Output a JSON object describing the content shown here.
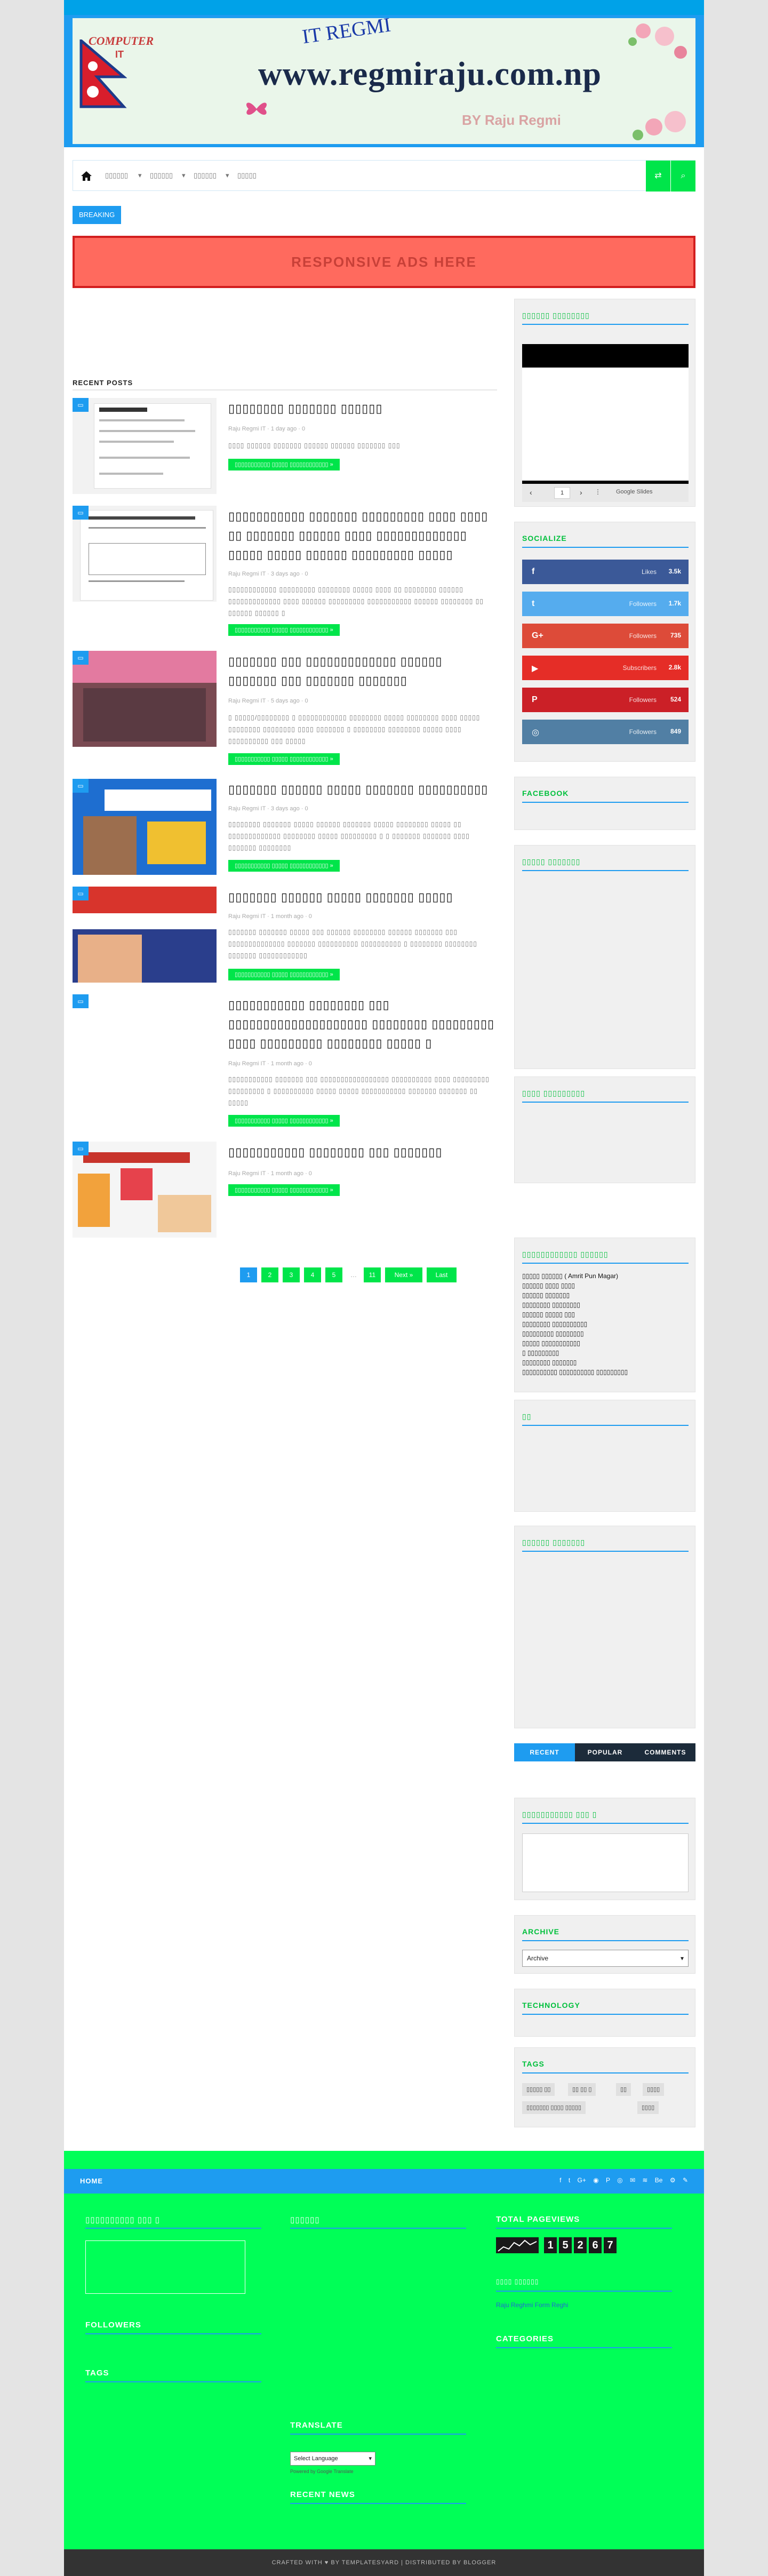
{
  "header": {
    "brand_name": "COMPUTER",
    "brand_suffix": "IT",
    "site_title": "IT REGMI",
    "domain": "www.regmiraju.com.np",
    "byline": "BY Raju Regmi"
  },
  "nav": {
    "items": [
      "▯▯▯▯▯▯",
      "▯▯▯▯▯▯",
      "▯▯▯▯▯▯",
      "▯▯▯▯▯"
    ],
    "shuffle_icon": "shuffle-icon",
    "search_icon": "search-icon"
  },
  "breaking_label": "BREAKING",
  "ads_text": "RESPONSIVE ADS HERE",
  "recent_posts": {
    "title": "RECENT POSTS",
    "read_more": "▯▯▯▯▯▯▯▯▯▯▯ ▯▯▯▯▯ ▯▯▯▯▯▯▯▯▯▯▯▯ »",
    "posts": [
      {
        "title": "▯▯▯▯▯▯▯▯ ▯▯▯▯▯▯▯ ▯▯▯▯▯▯",
        "meta": "Raju Regmi IT  ·  1 day ago  ·  0",
        "excerpt": "▯▯▯▯ ▯▯▯▯▯▯ ▯▯▯▯▯▯▯ ▯▯▯▯▯▯ ▯▯▯▯▯▯ ▯▯▯▯▯▯▯ ▯▯▯"
      },
      {
        "title": "▯▯▯▯▯▯▯▯▯▯▯ ▯▯▯▯▯▯▯ ▯▯▯▯▯▯▯▯▯ ▯▯▯▯ ▯▯▯▯ ▯▯ ▯▯▯▯▯▯▯ ▯▯▯▯▯▯ ▯▯▯▯ ▯▯▯▯▯▯▯▯▯▯▯▯▯ ▯▯▯▯▯ ▯▯▯▯▯ ▯▯▯▯▯▯ ▯▯▯▯▯▯▯▯▯ ▯▯▯▯▯",
        "meta": "Raju Regmi IT  ·  3 days ago  ·  0",
        "excerpt": "▯▯▯▯▯▯▯▯▯▯▯▯ ▯▯▯▯▯▯▯▯▯ ▯▯▯▯▯▯▯▯ ▯▯▯▯▯ ▯▯▯▯ ▯▯ ▯▯▯▯▯▯▯▯ ▯▯▯▯▯▯ ▯▯▯▯▯▯▯▯▯▯▯▯▯ ▯▯▯▯ ▯▯▯▯▯▯ ▯▯▯▯▯▯▯▯▯ ▯▯▯▯▯▯▯▯▯▯▯ ▯▯▯▯▯▯ ▯▯▯▯▯▯▯▯ ▯▯ ▯▯▯▯▯▯ ▯▯▯▯▯▯ ▯"
      },
      {
        "title": "▯▯▯▯▯▯▯ ▯▯▯ ▯▯▯▯▯▯▯▯▯▯▯▯▯ ▯▯▯▯▯▯ ▯▯▯▯▯▯▯ ▯▯▯ ▯▯▯▯▯▯▯ ▯▯▯▯▯▯▯",
        "meta": "Raju Regmi IT  ·  5 days ago  ·  0",
        "excerpt": "▯ ▯▯▯▯▯/▯▯▯▯▯▯▯▯ ▯ ▯▯▯▯▯▯▯▯▯▯▯▯ ▯▯▯▯▯▯▯▯ ▯▯▯▯▯ ▯▯▯▯▯▯▯▯ ▯▯▯▯ ▯▯▯▯▯ ▯▯▯▯▯▯▯▯ ▯▯▯▯▯▯▯▯ ▯▯▯▯ ▯▯▯▯▯▯▯ ▯ ▯▯▯▯▯▯▯▯ ▯▯▯▯▯▯▯▯ ▯▯▯▯▯ ▯▯▯▯ ▯▯▯▯▯▯▯▯▯▯ ▯▯▯ ▯▯▯▯▯"
      },
      {
        "title": "▯▯▯▯▯▯▯ ▯▯▯▯▯▯ ▯▯▯▯▯ ▯▯▯▯▯▯▯ ▯▯▯▯▯▯▯▯▯▯",
        "meta": "Raju Regmi IT  ·  3 days ago  ·  0",
        "excerpt": "▯▯▯▯▯▯▯▯ ▯▯▯▯▯▯▯ ▯▯▯▯▯ ▯▯▯▯▯▯ ▯▯▯▯▯▯▯ ▯▯▯▯▯ ▯▯▯▯▯▯▯▯ ▯▯▯▯▯ ▯▯ ▯▯▯▯▯▯▯▯▯▯▯▯▯ ▯▯▯▯▯▯▯▯ ▯▯▯▯▯ ▯▯▯▯▯▯▯▯▯ ▯ ▯ ▯▯▯▯▯▯▯ ▯▯▯▯▯▯▯ ▯▯▯▯ ▯▯▯▯▯▯▯ ▯▯▯▯▯▯▯▯"
      },
      {
        "title": "▯▯▯▯▯▯▯ ▯▯▯▯▯▯ ▯▯▯▯▯ ▯▯▯▯▯▯▯ ▯▯▯▯▯",
        "meta": "Raju Regmi IT  ·  1 month ago  ·  0",
        "excerpt": "▯▯▯▯▯▯▯ ▯▯▯▯▯▯▯ ▯▯▯▯▯ ▯▯▯ ▯▯▯▯▯▯ ▯▯▯▯▯▯▯▯ ▯▯▯▯▯▯ ▯▯▯▯▯▯▯ ▯▯▯ ▯▯▯▯▯▯▯▯▯▯▯▯▯▯ ▯▯▯▯▯▯▯ ▯▯▯▯▯▯▯▯▯▯ ▯▯▯▯▯▯▯▯▯▯ ▯ ▯▯▯▯▯▯▯▯ ▯▯▯▯▯▯▯▯ ▯▯▯▯▯▯▯ ▯▯▯▯▯▯▯▯▯▯▯▯"
      },
      {
        "title": "▯▯▯▯▯▯▯▯▯▯▯ ▯▯▯▯▯▯▯▯ ▯▯▯ ▯▯▯▯▯▯▯▯▯▯▯▯▯▯▯▯▯▯▯▯ ▯▯▯▯▯▯▯▯ ▯▯▯▯▯▯▯▯▯ ▯▯▯▯ ▯▯▯▯▯▯▯▯▯ ▯▯▯▯▯▯▯▯ ▯▯▯▯▯ ▯",
        "meta": "Raju Regmi IT  ·  1 month ago  ·  0",
        "excerpt": "▯▯▯▯▯▯▯▯▯▯▯ ▯▯▯▯▯▯▯ ▯▯▯ ▯▯▯▯▯▯▯▯▯▯▯▯▯▯▯▯▯ ▯▯▯▯▯▯▯▯▯▯ ▯▯▯▯ ▯▯▯▯▯▯▯▯▯ ▯▯▯▯▯▯▯▯▯ ▯ ▯▯▯▯▯▯▯▯▯▯ ▯▯▯▯▯ ▯▯▯▯▯ ▯▯▯▯▯▯▯▯▯▯▯ ▯▯▯▯▯▯▯ ▯▯▯▯▯▯▯ ▯▯ ▯▯▯▯▯"
      },
      {
        "title": "▯▯▯▯▯▯▯▯▯▯▯ ▯▯▯▯▯▯▯▯ ▯▯▯ ▯▯▯▯▯▯▯",
        "meta": "Raju Regmi IT  ·  1 month ago  ·  0",
        "excerpt": ""
      }
    ]
  },
  "pagination": {
    "pages": [
      "1",
      "2",
      "3",
      "4",
      "5",
      "…",
      "11"
    ],
    "next": "Next »",
    "last": "Last"
  },
  "sidebar": {
    "slides_title": "▯▯▯▯▯▯ ▯▯▯▯▯▯▯▯",
    "slides_page": "1",
    "slides_brand": "Google Slides",
    "socialize_title": "SOCIALIZE",
    "social": [
      {
        "icon": "facebook-icon",
        "glyph": "f",
        "label": "Likes",
        "count": "3.5k",
        "color": "#3b5998"
      },
      {
        "icon": "twitter-icon",
        "glyph": "t",
        "label": "Followers",
        "count": "1.7k",
        "color": "#55acee"
      },
      {
        "icon": "google-plus-icon",
        "glyph": "G+",
        "label": "Followers",
        "count": "735",
        "color": "#dd4b39"
      },
      {
        "icon": "youtube-icon",
        "glyph": "▶",
        "label": "Subscribers",
        "count": "2.8k",
        "color": "#e52d27"
      },
      {
        "icon": "pinterest-icon",
        "glyph": "P",
        "label": "Followers",
        "count": "524",
        "color": "#cb2027"
      },
      {
        "icon": "instagram-icon",
        "glyph": "◎",
        "label": "Followers",
        "count": "849",
        "color": "#517fa4"
      }
    ],
    "facebook_title": "FACEBOOK",
    "widget3_title": "▯▯▯▯▯ ▯▯▯▯▯▯▯",
    "widget4_title": "▯▯▯▯ ▯▯▯▯▯▯▯▯▯",
    "links_title": "▯▯▯▯▯▯▯▯▯▯▯▯ ▯▯▯▯▯▯",
    "links": [
      "▯▯▯▯▯ ▯▯▯▯▯▯ ( Amrit Pun Magar)",
      "▯▯▯▯▯▯ ▯▯▯▯ ▯▯▯▯",
      "▯▯▯▯▯▯ ▯▯▯▯▯▯▯",
      "▯▯▯▯▯▯▯▯ ▯▯▯▯▯▯▯▯",
      "▯▯▯▯▯▯ ▯▯▯▯▯ ▯▯▯",
      "▯▯▯▯▯▯▯▯ ▯▯▯▯▯▯▯▯▯▯",
      "▯▯▯▯▯▯▯▯▯ ▯▯▯▯▯▯▯▯",
      "▯▯▯▯▯ ▯▯▯▯▯▯▯▯▯▯▯",
      "▯ ▯▯▯▯▯▯▯▯▯",
      "▯▯▯▯▯▯▯▯ ▯▯▯▯▯▯▯",
      "▯▯▯▯▯▯▯▯▯▯ ▯▯▯▯▯▯▯▯▯▯ ▯▯▯▯▯▯▯▯▯"
    ],
    "widget6_title": "▯▯",
    "widget7_title": "▯▯▯▯▯▯ ▯▯▯▯▯▯▯",
    "tabs": [
      "RECENT",
      "POPULAR",
      "COMMENTS"
    ],
    "contact_title": "▯▯▯▯▯▯▯▯▯▯▯ ▯▯▯ ▯",
    "archive_title": "ARCHIVE",
    "archive_select": "Archive",
    "technology_title": "TECHNOLOGY",
    "tags_title": "TAGS",
    "tags": [
      "▯▯▯▯▯ ▯▯",
      "▯▯ ▯▯ ▯",
      "▯▯",
      "▯▯▯▯",
      "▯▯▯▯▯▯▯ ▯▯▯▯ ▯▯▯▯▯",
      "▯▯▯▯"
    ]
  },
  "footer": {
    "home": "HOME",
    "social_icons": [
      "f",
      "t",
      "G+",
      "◉",
      "P",
      "◎",
      "✉",
      "≋",
      "Be",
      "⚙",
      "✎"
    ],
    "col1": {
      "contact_title": "▯▯▯▯▯▯▯▯▯▯ ▯▯▯ ▯",
      "followers_title": "FOLLOWERS",
      "tags_title": "TAGS"
    },
    "col2": {
      "title1": "▯▯▯▯▯▯",
      "translate_title": "TRANSLATE",
      "translate_select": "Select Language",
      "powered": "Powered by Google Translate",
      "recent_title": "RECENT NEWS"
    },
    "col3": {
      "pageviews_title": "TOTAL PAGEVIEWS",
      "pageviews": [
        "1",
        "5",
        "2",
        "6",
        "7"
      ],
      "title2": "▯▯▯▯ ▯▯▯▯▯▯",
      "link": "Raju Reghmi Form Reghi",
      "categories_title": "CATEGORIES"
    },
    "copyright": "CRAFTED WITH ♥ BY TEMPLATESYARD | DISTRIBUTED BY BLOGGER"
  },
  "colors": {
    "accent": "#1e9cf0",
    "green": "#00e54a",
    "footer_bg": "#00ff57"
  }
}
